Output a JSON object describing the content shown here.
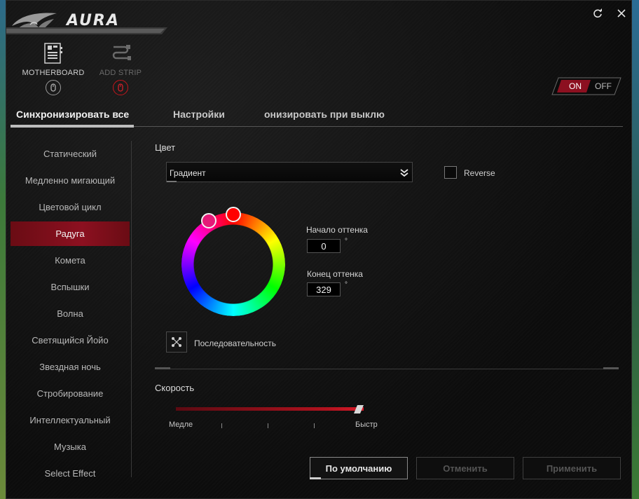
{
  "app": {
    "title": "AURA"
  },
  "devices": [
    {
      "label": "MOTHERBOARD",
      "state": "active"
    },
    {
      "label": "ADD STRIP",
      "state": "inactive"
    }
  ],
  "power_toggle": {
    "on_label": "ON",
    "off_label": "OFF",
    "selected": "ON"
  },
  "tabs": [
    {
      "label": "Синхронизировать все",
      "active": true
    },
    {
      "label": "Настройки",
      "active": false
    },
    {
      "label": "онизировать при выклю",
      "active": false
    }
  ],
  "effects": [
    "Статический",
    "Медленно мигающий",
    "Цветовой цикл",
    "Радуга",
    "Комета",
    "Вспышки",
    "Волна",
    "Светящийся Йойо",
    "Звездная ночь",
    "Стробирование",
    "Интеллектуальный",
    "Музыка",
    "Select Effect"
  ],
  "selected_effect": "Радуга",
  "color": {
    "section_label": "Цвет",
    "mode": "Градиент",
    "reverse_label": "Reverse",
    "reverse_checked": false,
    "hue_start_label": "Начало оттенка",
    "hue_start": "0",
    "hue_end_label": "Конец оттенка",
    "hue_end": "329",
    "degree_symbol": "°",
    "sequence_label": "Последовательность"
  },
  "speed": {
    "label": "Скорость",
    "slow_label": "Медле",
    "fast_label": "Быстр",
    "value_fraction": 1.0
  },
  "buttons": {
    "default_label": "По умолчанию",
    "cancel_label": "Отменить",
    "apply_label": "Применить"
  },
  "colors": {
    "accent_red": "#b0121e",
    "handle_start": "#ff0000",
    "handle_end": "#ff1a8c"
  }
}
